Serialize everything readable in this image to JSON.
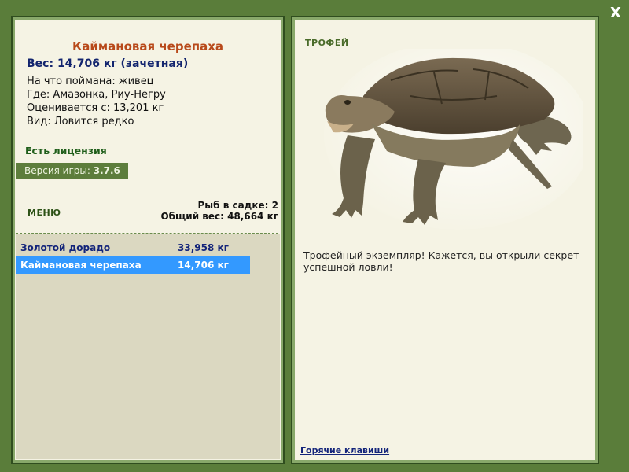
{
  "close_label": "X",
  "fish": {
    "name": "Каймановая черепаха",
    "weight": "Вес: 14,706 кг (зачетная)",
    "caught_on": "На что поймана: живец",
    "where": "Где: Амазонка, Риу-Негру",
    "rated_from": "Оценивается с: 13,201 кг",
    "kind": "Вид: Ловится редко"
  },
  "license": "Есть лицензия",
  "version": {
    "label": "Версия игры:",
    "value": "3.7.6"
  },
  "menu": "МЕНЮ",
  "keepnet": {
    "count": "Рыб в садке: 2",
    "total": "Общий вес: 48,664 кг"
  },
  "catch_list": [
    {
      "name": "Золотой дорадо",
      "weight": "33,958 кг"
    },
    {
      "name": "Каймановая черепаха",
      "weight": "14,706 кг"
    }
  ],
  "trophy_label": "ТРОФЕЙ",
  "description": "Трофейный экземпляр! Кажется, вы открыли секрет успешной ловли!",
  "hotkeys": "Горячие клавиши",
  "colors": {
    "frame": "#5a7d3a",
    "panel": "#f5f3e4",
    "title": "#b8491a",
    "selection": "#3399ff"
  }
}
